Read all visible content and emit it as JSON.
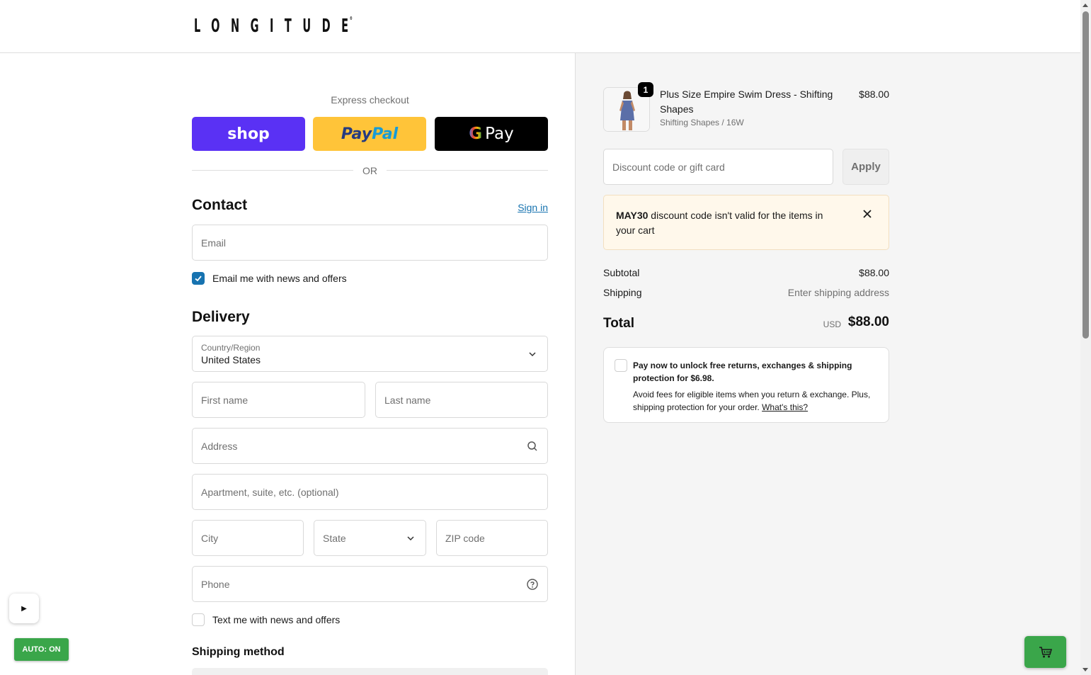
{
  "brand": {
    "name": "LONGITUDE",
    "registered": "®"
  },
  "express": {
    "label": "Express checkout",
    "shop_label": "shop",
    "paypal_part1": "Pay",
    "paypal_part2": "Pal",
    "gpay_g": "G",
    "gpay_label": "Pay",
    "or_label": "OR"
  },
  "contact": {
    "heading": "Contact",
    "sign_in": "Sign in",
    "email_placeholder": "Email",
    "news_optin": "Email me with news and offers",
    "news_checked": true
  },
  "delivery": {
    "heading": "Delivery",
    "country_label": "Country/Region",
    "country_value": "United States",
    "first_name_placeholder": "First name",
    "last_name_placeholder": "Last name",
    "address_placeholder": "Address",
    "apartment_placeholder": "Apartment, suite, etc. (optional)",
    "city_placeholder": "City",
    "state_placeholder": "State",
    "zip_placeholder": "ZIP code",
    "phone_placeholder": "Phone",
    "sms_optin": "Text me with news and offers",
    "sms_checked": false
  },
  "shipping_method": {
    "heading": "Shipping method"
  },
  "order": {
    "item": {
      "quantity": "1",
      "name": "Plus Size Empire Swim Dress - Shifting Shapes",
      "variant": "Shifting Shapes / 16W",
      "price": "$88.00"
    },
    "discount_placeholder": "Discount code or gift card",
    "apply_label": "Apply",
    "alert": {
      "code": "MAY30",
      "message": " discount code isn't valid for the items in your cart"
    },
    "subtotal_label": "Subtotal",
    "subtotal_value": "$88.00",
    "shipping_label": "Shipping",
    "shipping_value": "Enter shipping address",
    "total_label": "Total",
    "total_currency": "USD",
    "total_value": "$88.00"
  },
  "protection": {
    "title": "Pay now to unlock free returns, exchanges & shipping protection for $6.98.",
    "body": "Avoid fees for eligible items when you return & exchange. Plus, shipping protection for your order. ",
    "link": "What's this?"
  },
  "widgets": {
    "play_glyph": "▶",
    "auto_label": "AUTO: ON"
  },
  "colors": {
    "shop_bg": "#5a31f4",
    "paypal_bg": "#ffc439",
    "gpay_bg": "#000000",
    "link": "#1773b0",
    "alert_bg": "#fff8eb",
    "auto_green": "#3aa64a"
  }
}
